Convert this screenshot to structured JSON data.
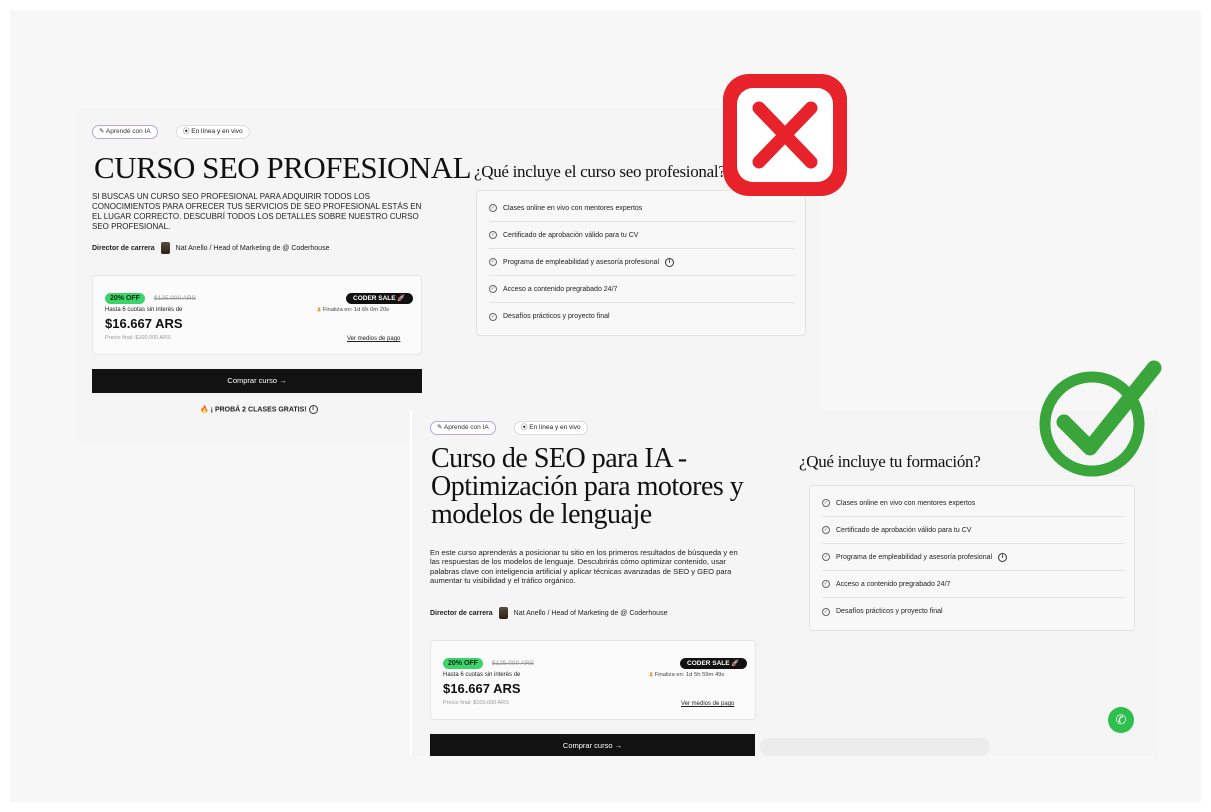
{
  "bad": {
    "pill_ia": "✎ Aprendé con IA",
    "pill_live": "⦿ En línea y en vivo",
    "title": "CURSO SEO PROFESIONAL",
    "description": "SI BUSCAS UN CURSO SEO PROFESIONAL PARA ADQUIRIR TODOS LOS CONOCIMIENTOS PARA OFRECER TUS SERVICIOS DE SEO PROFESIONAL ESTÁS EN EL LUGAR CORRECTO. DESCUBRÍ TODOS LOS DETALLES SOBRE NUESTRO CURSO SEO PROFESIONAL.",
    "director_label": "Director de carrera",
    "director_name": "Nat Anello / Head of Marketing de @ Coderhouse",
    "price": {
      "off_badge": "20% OFF",
      "old_price": "$125.000 ARS",
      "cuotas": "Hasta 6 cuotas sin interés de",
      "price": "$16.667 ARS",
      "final": "Precio final: $100.000 ARS",
      "sale_badge": "CODER SALE 🚀",
      "finaliza": "Finaliza en: 1d 6h 0m 20s",
      "medios": "Ver medios de pago"
    },
    "buy_button": "Comprar curso →",
    "proba": "¡ PROBÁ 2 CLASES GRATIS!",
    "includes_title": "¿Qué incluye el curso seo profesional?",
    "includes": [
      "Clases online en vivo con mentores expertos",
      "Certificado de aprobación válido para tu CV",
      "Programa de empleabilidad y asesoría profesional",
      "Acceso a contenido pregrabado 24/7",
      "Desafíos prácticos y proyecto final"
    ]
  },
  "good": {
    "pill_ia": "✎ Aprendé con IA",
    "pill_live": "⦿ En línea y en vivo",
    "title": "Curso de SEO para IA - Optimización para motores y modelos de lenguaje",
    "description": "En este curso aprenderás a posicionar tu sitio en los primeros resultados de búsqueda y en las respuestas de los modelos de lenguaje. Descubrirás cómo optimizar contenido, usar palabras clave con inteligencia artificial y aplicar técnicas avanzadas de SEO y GEO para aumentar tu visibilidad y el tráfico orgánico.",
    "director_label": "Director de carrera",
    "director_name": "Nat Anello / Head of Marketing de @ Coderhouse",
    "price": {
      "off_badge": "20% OFF",
      "old_price": "$125.000 ARS",
      "cuotas": "Hasta 6 cuotas sin interés de",
      "price": "$16.667 ARS",
      "final": "Precio final: $100.000 ARS",
      "sale_badge": "CODER SALE 🚀",
      "finaliza": "Finaliza en: 1d 5h 59m 49s",
      "medios": "Ver medios de pago"
    },
    "buy_button": "Comprar curso →",
    "includes_title": "¿Qué incluye tu formación?",
    "includes": [
      "Clases online en vivo con mentores expertos",
      "Certificado de aprobación válido para tu CV",
      "Programa de empleabilidad y asesoría profesional",
      "Acceso a contenido pregrabado 24/7",
      "Desafíos prácticos y proyecto final"
    ]
  },
  "icons": {
    "bad_mark": "red-x-icon",
    "good_mark": "green-check-icon",
    "whatsapp": "whatsapp-icon",
    "hourglass": "hourglass-icon",
    "check_circle": "check-circle-icon",
    "info": "info-icon"
  },
  "colors": {
    "off_badge": "#3dd36b",
    "bad_mark": "#e8222b",
    "good_mark": "#3aa53a",
    "button": "#121212"
  }
}
